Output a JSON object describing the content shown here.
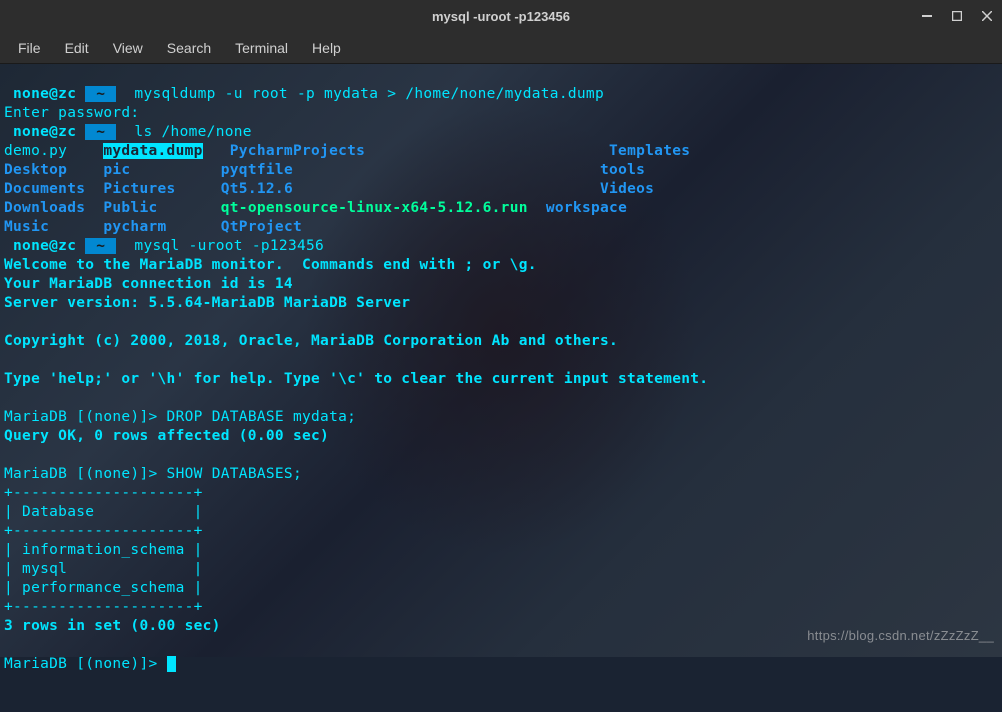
{
  "window": {
    "title": "mysql -uroot -p123456"
  },
  "menu": {
    "file": "File",
    "edit": "Edit",
    "view": "View",
    "search": "Search",
    "terminal": "Terminal",
    "help": "Help"
  },
  "prompt": {
    "user": " none@zc ",
    "tilde": " ~ "
  },
  "cmd": {
    "c1": "  mysqldump -u root -p mydata > /home/none/mydata.dump",
    "c2": "  ls /home/none",
    "c3": "  mysql -uroot -p123456"
  },
  "lines": {
    "enter_pwd": "Enter password: ",
    "welcome": "Welcome to the MariaDB monitor.  Commands end with ; or \\g.",
    "conn_id": "Your MariaDB connection id is 14",
    "server_ver": "Server version: 5.5.64-MariaDB MariaDB Server",
    "copyright": "Copyright (c) 2000, 2018, Oracle, MariaDB Corporation Ab and others.",
    "help": "Type 'help;' or '\\h' for help. Type '\\c' to clear the current input statement.",
    "mdb_prompt": "MariaDB [(none)]> ",
    "drop": "DROP DATABASE mydata;",
    "query_ok": "Query OK, 0 rows affected (0.00 sec)",
    "show": "SHOW DATABASES;",
    "tbl_sep": "+--------------------+",
    "tbl_hdr": "| Database           |",
    "tbl_r1": "| information_schema |",
    "tbl_r2": "| mysql              |",
    "tbl_r3": "| performance_schema |",
    "rows": "3 rows in set (0.00 sec)"
  },
  "ls": {
    "r1c1": "demo.py    ",
    "r1c2": "mydata.dump",
    "r1c3": "   ",
    "r1c4": "PycharmProjects",
    "r1c5": "                           ",
    "r1c6": "Templates",
    "r2c1": "Desktop",
    "r2c2": "    ",
    "r2c3": "pic",
    "r2c4": "          ",
    "r2c5": "pyqtfile",
    "r2c6": "                                  ",
    "r2c7": "tools",
    "r3c1": "Documents",
    "r3c2": "  ",
    "r3c3": "Pictures",
    "r3c4": "     ",
    "r3c5": "Qt5.12.6",
    "r3c6": "                                  ",
    "r3c7": "Videos",
    "r4c1": "Downloads",
    "r4c2": "  ",
    "r4c3": "Public",
    "r4c4": "       ",
    "r4c5": "qt-opensource-linux-x64-5.12.6.run",
    "r4c6": "  ",
    "r4c7": "workspace",
    "r5c1": "Music",
    "r5c2": "      ",
    "r5c3": "pycharm",
    "r5c4": "      ",
    "r5c5": "QtProject"
  },
  "watermark": "https://blog.csdn.net/zZzZzZ__"
}
